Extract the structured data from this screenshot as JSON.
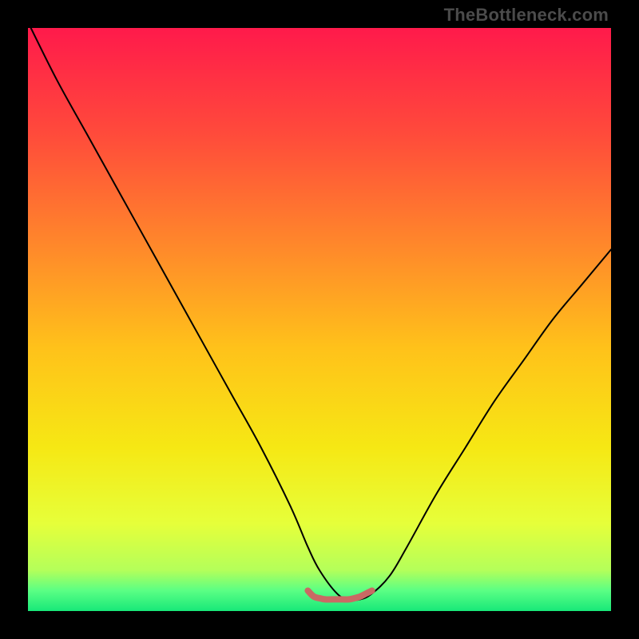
{
  "watermark": "TheBottleneck.com",
  "chart_data": {
    "type": "line",
    "title": "",
    "xlabel": "",
    "ylabel": "",
    "xlim": [
      0,
      100
    ],
    "ylim": [
      0,
      100
    ],
    "grid": false,
    "legend": false,
    "background_gradient": {
      "stops": [
        {
          "offset": 0.0,
          "color": "#ff1a4b"
        },
        {
          "offset": 0.18,
          "color": "#ff4a3b"
        },
        {
          "offset": 0.38,
          "color": "#ff8a2a"
        },
        {
          "offset": 0.55,
          "color": "#ffc21a"
        },
        {
          "offset": 0.72,
          "color": "#f6e814"
        },
        {
          "offset": 0.85,
          "color": "#e6ff3a"
        },
        {
          "offset": 0.93,
          "color": "#b4ff5a"
        },
        {
          "offset": 0.965,
          "color": "#5aff84"
        },
        {
          "offset": 1.0,
          "color": "#18e879"
        }
      ]
    },
    "series": [
      {
        "name": "bottleneck-curve",
        "color": "#000000",
        "stroke_width": 2,
        "x": [
          0.5,
          5,
          10,
          15,
          20,
          25,
          30,
          35,
          40,
          45,
          48,
          50,
          53,
          55,
          57,
          59,
          62,
          65,
          70,
          75,
          80,
          85,
          90,
          95,
          100
        ],
        "y": [
          100,
          91,
          82,
          73,
          64,
          55,
          46,
          37,
          28,
          18,
          11,
          7,
          3,
          2,
          2,
          3,
          6,
          11,
          20,
          28,
          36,
          43,
          50,
          56,
          62
        ]
      },
      {
        "name": "optimal-marker",
        "color": "#c96a64",
        "stroke_width": 8,
        "x": [
          48,
          49,
          50,
          51,
          52,
          53,
          54,
          55,
          56,
          57,
          58,
          59
        ],
        "y": [
          3.5,
          2.5,
          2.2,
          2.0,
          2.0,
          2.0,
          2.0,
          2.0,
          2.2,
          2.5,
          3.0,
          3.5
        ]
      }
    ]
  }
}
